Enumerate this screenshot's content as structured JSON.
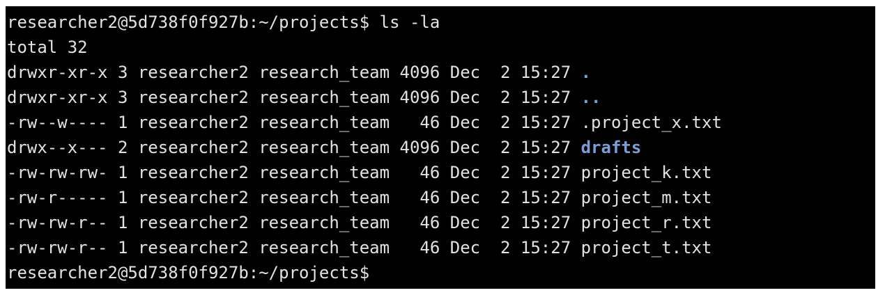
{
  "terminal": {
    "prompt": "researcher2@5d738f0f927b:~/projects$",
    "command": "ls -la",
    "total_line": "total 32",
    "entries": [
      {
        "perms": "drwxr-xr-x",
        "links": "3",
        "owner": "researcher2",
        "group": "research_team",
        "size": "4096",
        "month": "Dec",
        "day": "2",
        "time": "15:27",
        "name": ".",
        "is_dir": true
      },
      {
        "perms": "drwxr-xr-x",
        "links": "3",
        "owner": "researcher2",
        "group": "research_team",
        "size": "4096",
        "month": "Dec",
        "day": "2",
        "time": "15:27",
        "name": "..",
        "is_dir": true
      },
      {
        "perms": "-rw--w----",
        "links": "1",
        "owner": "researcher2",
        "group": "research_team",
        "size": "46",
        "month": "Dec",
        "day": "2",
        "time": "15:27",
        "name": ".project_x.txt",
        "is_dir": false
      },
      {
        "perms": "drwx--x---",
        "links": "2",
        "owner": "researcher2",
        "group": "research_team",
        "size": "4096",
        "month": "Dec",
        "day": "2",
        "time": "15:27",
        "name": "drafts",
        "is_dir": true
      },
      {
        "perms": "-rw-rw-rw-",
        "links": "1",
        "owner": "researcher2",
        "group": "research_team",
        "size": "46",
        "month": "Dec",
        "day": "2",
        "time": "15:27",
        "name": "project_k.txt",
        "is_dir": false
      },
      {
        "perms": "-rw-r-----",
        "links": "1",
        "owner": "researcher2",
        "group": "research_team",
        "size": "46",
        "month": "Dec",
        "day": "2",
        "time": "15:27",
        "name": "project_m.txt",
        "is_dir": false
      },
      {
        "perms": "-rw-rw-r--",
        "links": "1",
        "owner": "researcher2",
        "group": "research_team",
        "size": "46",
        "month": "Dec",
        "day": "2",
        "time": "15:27",
        "name": "project_r.txt",
        "is_dir": false
      },
      {
        "perms": "-rw-rw-r--",
        "links": "1",
        "owner": "researcher2",
        "group": "research_team",
        "size": "46",
        "month": "Dec",
        "day": "2",
        "time": "15:27",
        "name": "project_t.txt",
        "is_dir": false
      }
    ],
    "final_prompt": "researcher2@5d738f0f927b:~/projects$"
  },
  "colors": {
    "background": "#000000",
    "text": "#e2e2e2",
    "directory": "#7b9fd6"
  }
}
